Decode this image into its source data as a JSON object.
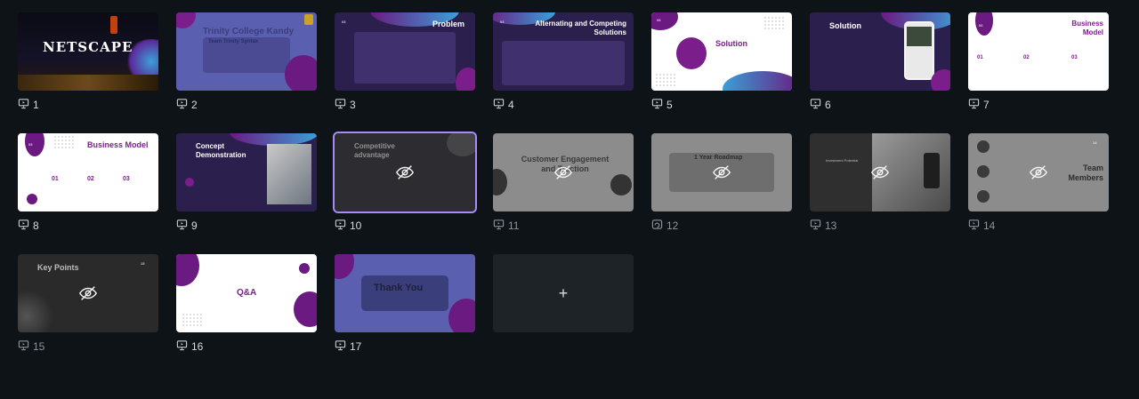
{
  "slides": [
    {
      "number": "1",
      "title": "NETSCAPE",
      "subtitle": "",
      "hidden": false
    },
    {
      "number": "2",
      "title": "Trinity College Kandy",
      "subtitle": "Team Trinity Syntax",
      "hidden": false
    },
    {
      "number": "3",
      "title": "Problem",
      "subtitle": "03",
      "hidden": false
    },
    {
      "number": "4",
      "title": "Alternating and Competing Solutions",
      "subtitle": "03",
      "hidden": false
    },
    {
      "number": "5",
      "title": "Solution",
      "subtitle": "08",
      "hidden": false
    },
    {
      "number": "6",
      "title": "Solution",
      "subtitle": "",
      "hidden": false
    },
    {
      "number": "7",
      "title": "Business Model",
      "subtitle": "06",
      "hidden": false
    },
    {
      "number": "8",
      "title": "Business Model",
      "subtitle": "05",
      "hidden": false
    },
    {
      "number": "9",
      "title": "Concept Demonstration",
      "subtitle": "",
      "hidden": false
    },
    {
      "number": "10",
      "title": "Competitive advantage",
      "subtitle": "08",
      "hidden": true
    },
    {
      "number": "11",
      "title": "Customer Engagement and Traction",
      "subtitle": "",
      "hidden": true
    },
    {
      "number": "12",
      "title": "1 Year Roadmap",
      "subtitle": "",
      "hidden": true
    },
    {
      "number": "13",
      "title": "Investment Potential",
      "subtitle": "",
      "hidden": true
    },
    {
      "number": "14",
      "title": "Team Members",
      "subtitle": "14",
      "hidden": true
    },
    {
      "number": "15",
      "title": "Key Points",
      "subtitle": "15",
      "hidden": true
    },
    {
      "number": "16",
      "title": "Q&A",
      "subtitle": "",
      "hidden": false
    },
    {
      "number": "17",
      "title": "Thank You",
      "subtitle": "",
      "hidden": false
    }
  ],
  "add_slide": {
    "label": "+"
  },
  "colors": {
    "background": "#0e1318",
    "accent": "#a78bfa",
    "purple": "#7b1e8c",
    "navy": "#2b1f4d"
  }
}
